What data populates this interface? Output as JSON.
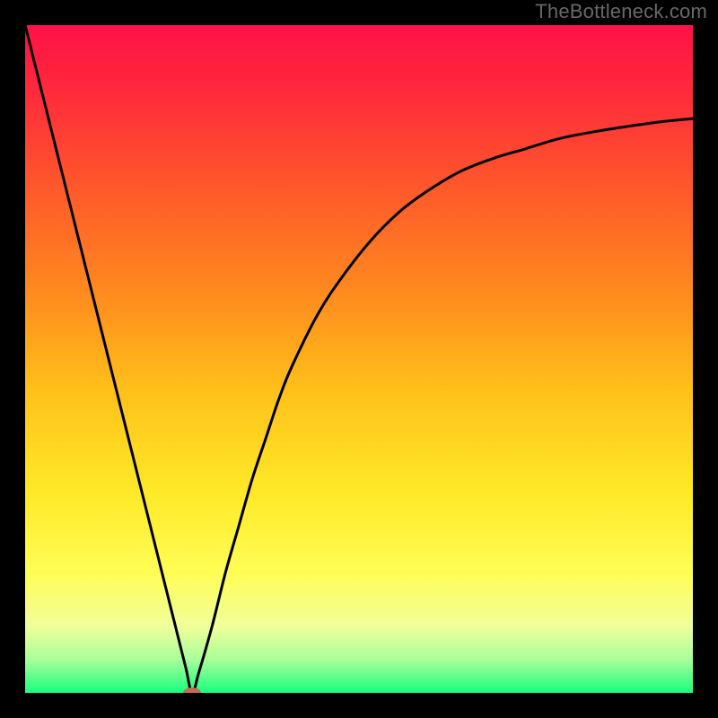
{
  "watermark": "TheBottleneck.com",
  "chart_data": {
    "type": "line",
    "title": "",
    "xlabel": "",
    "ylabel": "",
    "xlim": [
      0,
      100
    ],
    "ylim": [
      0,
      100
    ],
    "grid": false,
    "series": [
      {
        "name": "curve",
        "x": [
          0,
          2,
          4,
          6,
          8,
          10,
          12,
          14,
          16,
          18,
          20,
          22,
          24,
          25,
          26,
          28,
          30,
          32,
          34,
          36,
          38,
          40,
          44,
          48,
          52,
          56,
          60,
          65,
          70,
          75,
          80,
          85,
          90,
          95,
          100
        ],
        "values": [
          100,
          92,
          84,
          76,
          68,
          60,
          52,
          44,
          36,
          28,
          20,
          12,
          4,
          0,
          3,
          10,
          18,
          25,
          32,
          38,
          44,
          49,
          57,
          63,
          68,
          72,
          75,
          78,
          80,
          81.5,
          83,
          84,
          84.8,
          85.5,
          86
        ]
      }
    ],
    "background_gradient": {
      "stops": [
        {
          "offset": 0.0,
          "color": "#ff1148"
        },
        {
          "offset": 0.1,
          "color": "#ff2a3b"
        },
        {
          "offset": 0.25,
          "color": "#ff5a2a"
        },
        {
          "offset": 0.4,
          "color": "#ff8a1f"
        },
        {
          "offset": 0.55,
          "color": "#ffc11a"
        },
        {
          "offset": 0.7,
          "color": "#ffe928"
        },
        {
          "offset": 0.82,
          "color": "#fffd55"
        },
        {
          "offset": 0.9,
          "color": "#f0ff9a"
        },
        {
          "offset": 0.95,
          "color": "#a8ff9a"
        },
        {
          "offset": 1.0,
          "color": "#19ff7e"
        }
      ]
    },
    "marker": {
      "x": 25,
      "y": 0,
      "color": "#c46a5a",
      "rx": 10,
      "ry": 6
    }
  }
}
